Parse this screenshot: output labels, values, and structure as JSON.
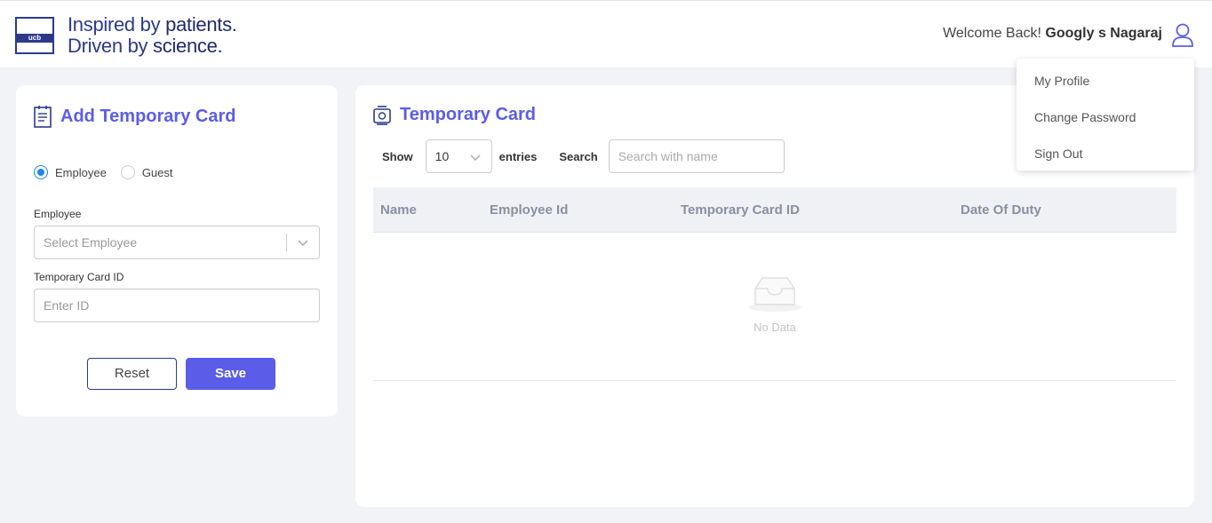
{
  "header": {
    "logo_mark": "ucb",
    "tagline_line1_a": "Inspired by ",
    "tagline_line1_b": "patients.",
    "tagline_line2_a": "Driven by ",
    "tagline_line2_b": "science.",
    "welcome": "Welcome Back!",
    "user_name": "Googly s Nagaraj",
    "user_icon": "user-icon"
  },
  "user_menu": {
    "items": [
      "My Profile",
      "Change Password",
      "Sign Out"
    ]
  },
  "add_card": {
    "title": "Add Temporary Card",
    "icon": "document-icon",
    "radio_employee": "Employee",
    "radio_guest": "Guest",
    "selected_type": "Employee",
    "employee_label": "Employee",
    "employee_placeholder": "Select Employee",
    "card_id_label": "Temporary Card ID",
    "card_id_placeholder": "Enter ID",
    "reset_label": "Reset",
    "save_label": "Save"
  },
  "list_card": {
    "title": "Temporary Card",
    "icon": "card-icon",
    "show_label": "Show",
    "entries_value": "10",
    "entries_label": "entries",
    "search_label": "Search",
    "search_placeholder": "Search with name",
    "columns": [
      "Name",
      "Employee Id",
      "Temporary Card ID",
      "Date Of Duty"
    ],
    "empty_text": "No Data"
  },
  "colors": {
    "accent": "#5b5de8",
    "brand": "#2d3a8c",
    "radio_selected": "#1e88e5"
  }
}
